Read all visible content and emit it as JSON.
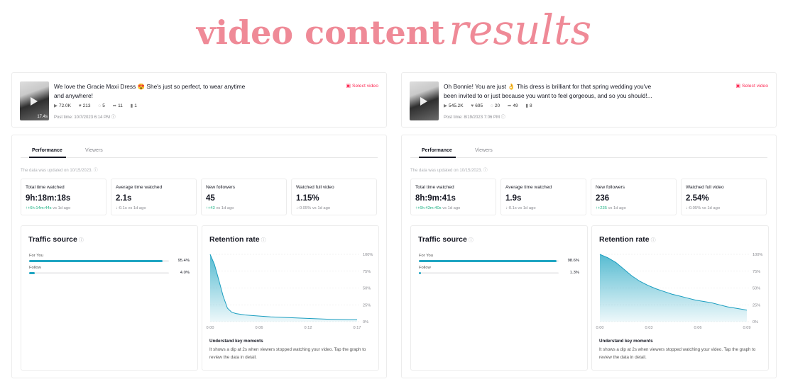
{
  "header": {
    "title_part1": "video content",
    "title_part2": "results"
  },
  "icons": {
    "play": "play-icon",
    "like": "heart-icon",
    "comment": "comment-icon",
    "share": "share-icon",
    "save": "bookmark-icon",
    "info": "info-icon",
    "select": "video-icon"
  },
  "colors": {
    "title": "#ef8a97",
    "accent": "#fe2c55",
    "bar": "#1fa5c2",
    "positive": "#20b385"
  },
  "panels": [
    {
      "video": {
        "caption": "We love the Gracie Maxi Dress 😍 She's just so perfect, to wear anytime and anywhere!",
        "duration": "17.4s",
        "views": "72.0K",
        "likes": "213",
        "comments": "5",
        "shares": "11",
        "saves": "1",
        "post_time": "Post time: 10/7/2023 6:14 PM",
        "select_label": "Select video"
      },
      "tabs": {
        "performance": "Performance",
        "viewers": "Viewers"
      },
      "updated": "The data was updated on 10/15/2023.",
      "metrics": [
        {
          "label": "Total time watched",
          "value": "9h:18m:18s",
          "delta": "+6h:14m:44s",
          "suffix": "vs 1d ago",
          "trend": "up"
        },
        {
          "label": "Average time watched",
          "value": "2.1s",
          "delta": "-0.1s",
          "suffix": "vs 1d ago",
          "trend": "down"
        },
        {
          "label": "New followers",
          "value": "45",
          "delta": "+43",
          "suffix": "vs 1d ago",
          "trend": "up"
        },
        {
          "label": "Watched full video",
          "value": "1.15%",
          "delta": "-0.05%",
          "suffix": "vs 1d ago",
          "trend": "down"
        }
      ],
      "traffic": {
        "title": "Traffic source",
        "sources": [
          {
            "label": "For You",
            "pct_text": "95.4%",
            "value": 95.4
          },
          {
            "label": "Follow",
            "pct_text": "4.0%",
            "value": 4.0
          }
        ]
      },
      "retention": {
        "title": "Retention rate",
        "key_moments_title": "Understand key moments",
        "key_moments_text": "It shows a dip at 2s when viewers stopped watching your video. Tap the graph to review the data in detail."
      }
    },
    {
      "video": {
        "caption": "Oh Bonnie! You are just 👌 This dress is brilliant for that spring wedding you've been invited to or just because you want to feel gorgeous, and so you should!...",
        "duration": "",
        "views": "545.2K",
        "likes": "695",
        "comments": "20",
        "shares": "49",
        "saves": "8",
        "post_time": "Post time: 8/19/2023 7:06 PM",
        "select_label": "Select video"
      },
      "tabs": {
        "performance": "Performance",
        "viewers": "Viewers"
      },
      "updated": "The data was updated on 10/15/2023.",
      "metrics": [
        {
          "label": "Total time watched",
          "value": "8h:9m:41s",
          "delta": "+6h:43m:40s",
          "suffix": "vs 1d ago",
          "trend": "up"
        },
        {
          "label": "Average time watched",
          "value": "1.9s",
          "delta": "-0.1s",
          "suffix": "vs 1d ago",
          "trend": "down"
        },
        {
          "label": "New followers",
          "value": "236",
          "delta": "+235",
          "suffix": "vs 1d ago",
          "trend": "up"
        },
        {
          "label": "Watched full video",
          "value": "2.54%",
          "delta": "-0.05%",
          "suffix": "vs 1d ago",
          "trend": "down"
        }
      ],
      "traffic": {
        "title": "Traffic source",
        "sources": [
          {
            "label": "For You",
            "pct_text": "98.6%",
            "value": 98.6
          },
          {
            "label": "Follow",
            "pct_text": "1.3%",
            "value": 1.3
          }
        ]
      },
      "retention": {
        "title": "Retention rate",
        "key_moments_title": "Understand key moments",
        "key_moments_text": "It shows a dip at 2s when viewers stopped watching your video. Tap the graph to review the data in detail."
      }
    }
  ],
  "chart_data": [
    {
      "type": "area",
      "title": "Retention rate",
      "x_ticks": [
        "0:00",
        "0:06",
        "0:12",
        "0:17"
      ],
      "y_ticks": [
        "100%",
        "75%",
        "50%",
        "25%",
        "0%"
      ],
      "ylim": [
        0,
        100
      ],
      "xlim": [
        0,
        17
      ],
      "x": [
        0,
        0.5,
        1,
        1.5,
        2,
        2.5,
        3,
        4,
        5,
        6,
        7,
        8,
        9,
        10,
        11,
        12,
        13,
        14,
        15,
        16,
        17
      ],
      "values": [
        100,
        85,
        62,
        38,
        20,
        14,
        12,
        10,
        9,
        8,
        7,
        6.5,
        6,
        5.5,
        5,
        4.5,
        4,
        3.5,
        3.2,
        3,
        2.8
      ]
    },
    {
      "type": "area",
      "title": "Retention rate",
      "x_ticks": [
        "0:00",
        "0:03",
        "0:06",
        "0:09"
      ],
      "y_ticks": [
        "100%",
        "75%",
        "50%",
        "25%",
        "0%"
      ],
      "ylim": [
        0,
        100
      ],
      "xlim": [
        0,
        9.2
      ],
      "x": [
        0,
        0.5,
        1,
        1.5,
        2,
        2.5,
        3,
        3.5,
        4,
        4.5,
        5,
        5.5,
        6,
        6.5,
        7,
        7.5,
        8,
        8.5,
        9,
        9.2
      ],
      "values": [
        100,
        95,
        88,
        78,
        68,
        60,
        54,
        49,
        45,
        41,
        38,
        35,
        32,
        30,
        28,
        25,
        22,
        20,
        18,
        17
      ]
    }
  ]
}
